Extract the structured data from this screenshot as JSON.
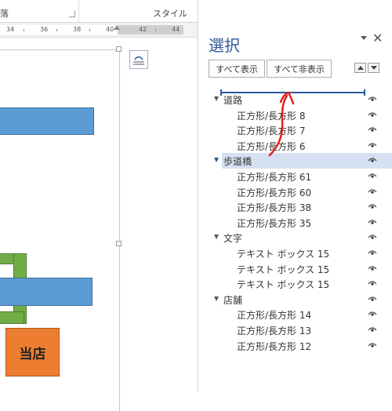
{
  "ribbon": {
    "group_paragraph": "落",
    "group_style": "スタイル"
  },
  "ruler": {
    "numbers": [
      "34",
      "36",
      "38",
      "40",
      "42",
      "44"
    ]
  },
  "document": {
    "store_label": "当店",
    "shape_colors": {
      "blue": "#5b9bd5",
      "green": "#70ad47",
      "orange": "#ed7d31"
    }
  },
  "selection_pane": {
    "title": "選択",
    "show_all": "すべて表示",
    "hide_all": "すべて非表示",
    "accent_color": "#2b579a",
    "groups": [
      {
        "name": "道路",
        "items": [
          "正方形/長方形 8",
          "正方形/長方形 7",
          "正方形/長方形 6"
        ]
      },
      {
        "name": "歩道橋",
        "selected": true,
        "items": [
          "正方形/長方形 61",
          "正方形/長方形 60",
          "正方形/長方形 38",
          "正方形/長方形 35"
        ]
      },
      {
        "name": "文字",
        "items": [
          "テキスト ボックス 15",
          "テキスト ボックス 15",
          "テキスト ボックス 15"
        ]
      },
      {
        "name": "店舗",
        "items": [
          "正方形/長方形 14",
          "正方形/長方形 13",
          "正方形/長方形 12"
        ]
      }
    ]
  },
  "annotation": {
    "type": "red-curved-arrow",
    "color": "#e02020"
  }
}
